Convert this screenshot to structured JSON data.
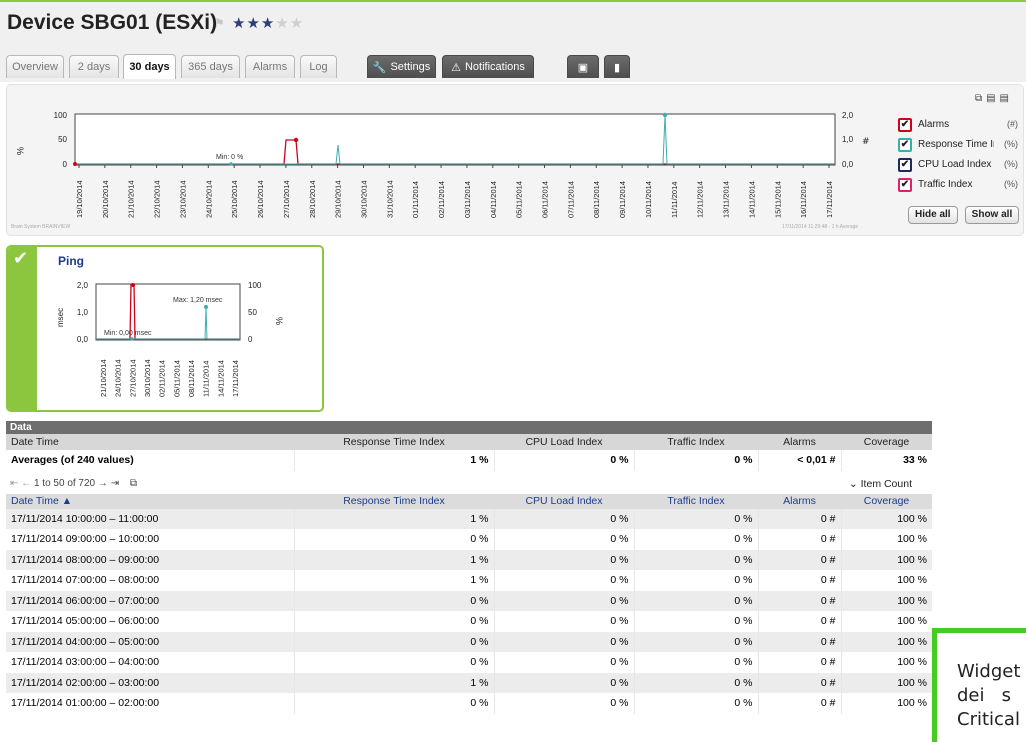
{
  "device": {
    "title": "Device SBG01 (ESXi)",
    "stars_on": "★★★",
    "stars_off": "★★"
  },
  "tabs": [
    {
      "label": "Overview"
    },
    {
      "label": "2 days"
    },
    {
      "label": "30 days"
    },
    {
      "label": "365 days"
    },
    {
      "label": "Alarms"
    },
    {
      "label": "Log"
    },
    {
      "label": "Settings"
    },
    {
      "label": "Notifications"
    }
  ],
  "main_chart": {
    "brand": "Brain System BRAINVIEW",
    "timestamp": "17/11/2014 11:29:48 - 1 h Average",
    "left_axis_label": "%",
    "left_ticks": [
      "100",
      "50",
      "0"
    ],
    "right_ticks": [
      "2,0",
      "1,0",
      "0,0"
    ],
    "right_unit": "#",
    "min_label": "Min: 0 %",
    "dates": [
      "19/10/2014",
      "20/10/2014",
      "21/10/2014",
      "22/10/2014",
      "23/10/2014",
      "24/10/2014",
      "25/10/2014",
      "26/10/2014",
      "27/10/2014",
      "28/10/2014",
      "29/10/2014",
      "30/10/2014",
      "31/10/2014",
      "01/11/2014",
      "02/11/2014",
      "03/11/2014",
      "04/11/2014",
      "05/11/2014",
      "06/11/2014",
      "07/11/2014",
      "08/11/2014",
      "09/11/2014",
      "10/11/2014",
      "11/11/2014",
      "12/11/2014",
      "13/11/2014",
      "14/11/2014",
      "15/11/2014",
      "16/11/2014",
      "17/11/2014"
    ]
  },
  "legend": {
    "items": [
      {
        "label": "Alarms",
        "unit": "(#)",
        "color": "#d0021b"
      },
      {
        "label": "Response Time In...",
        "unit": "(%)",
        "color": "#3aafaf"
      },
      {
        "label": "CPU Load Index",
        "unit": "(%)",
        "color": "#1d2a5c"
      },
      {
        "label": "Traffic Index",
        "unit": "(%)",
        "color": "#d6246e"
      }
    ],
    "hide_all": "Hide all",
    "show_all": "Show all"
  },
  "ping": {
    "title": "Ping",
    "left_unit": "msec",
    "right_unit": "%",
    "left_ticks": [
      "2,0",
      "1,0",
      "0,0"
    ],
    "right_ticks": [
      "100",
      "50",
      "0"
    ],
    "max_label": "Max: 1,20 msec",
    "min_label": "Min: 0,00 msec",
    "dates": [
      "21/10/2014",
      "24/10/2014",
      "27/10/2014",
      "30/10/2014",
      "02/11/2014",
      "05/11/2014",
      "08/11/2014",
      "11/11/2014",
      "14/11/2014",
      "17/11/2014"
    ]
  },
  "data": {
    "title": "Data",
    "columns": [
      "Date Time",
      "Response Time Index",
      "CPU Load Index",
      "Traffic Index",
      "Alarms",
      "Coverage"
    ],
    "sorted_columns": [
      "Date Time ▲",
      "Response Time Index",
      "CPU Load Index",
      "Traffic Index",
      "Alarms",
      "Coverage"
    ],
    "averages": [
      "Averages (of 240 values)",
      "1 %",
      "0 %",
      "0 %",
      "< 0,01 #",
      "33 %"
    ],
    "pager": "1 to 50 of 720",
    "item_count": "Item Count",
    "rows": [
      [
        "17/11/2014 10:00:00 – 11:00:00",
        "1 %",
        "0 %",
        "0 %",
        "0 #",
        "100 %"
      ],
      [
        "17/11/2014 09:00:00 – 10:00:00",
        "0 %",
        "0 %",
        "0 %",
        "0 #",
        "100 %"
      ],
      [
        "17/11/2014 08:00:00 – 09:00:00",
        "1 %",
        "0 %",
        "0 %",
        "0 #",
        "100 %"
      ],
      [
        "17/11/2014 07:00:00 – 08:00:00",
        "1 %",
        "0 %",
        "0 %",
        "0 #",
        "100 %"
      ],
      [
        "17/11/2014 06:00:00 – 07:00:00",
        "0 %",
        "0 %",
        "0 %",
        "0 #",
        "100 %"
      ],
      [
        "17/11/2014 05:00:00 – 06:00:00",
        "0 %",
        "0 %",
        "0 %",
        "0 #",
        "100 %"
      ],
      [
        "17/11/2014 04:00:00 – 05:00:00",
        "0 %",
        "0 %",
        "0 %",
        "0 #",
        "100 %"
      ],
      [
        "17/11/2014 03:00:00 – 04:00:00",
        "0 %",
        "0 %",
        "0 %",
        "0 #",
        "100 %"
      ],
      [
        "17/11/2014 02:00:00 – 03:00:00",
        "1 %",
        "0 %",
        "0 %",
        "0 #",
        "100 %"
      ],
      [
        "17/11/2014 01:00:00 – 02:00:00",
        "0 %",
        "0 %",
        "0 %",
        "0 #",
        "100 %"
      ]
    ]
  },
  "overlay": {
    "lines": [
      "Widget",
      "dei   s",
      "Critical"
    ]
  }
}
